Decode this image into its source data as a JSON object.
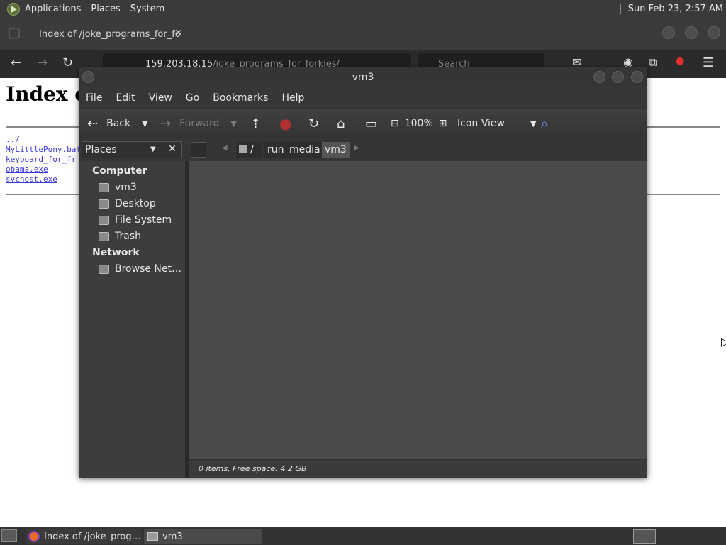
{
  "top_panel": {
    "menus": [
      "Applications",
      "Places",
      "System"
    ],
    "clock": "Sun Feb 23,  2:57 AM"
  },
  "firefox": {
    "tab_title": "Index of /joke_programs_for_fo",
    "tab_close": "×",
    "url_host": "159.203.18.15",
    "url_path": "/joke_programs_for_forkies/",
    "search_placeholder": "Search"
  },
  "page": {
    "heading": "Index of /joke_programs_for_forkies/",
    "links": [
      "../",
      "MyLittlePony.bat",
      "keyboard_for_fr",
      "obama.exe",
      "svchost.exe"
    ]
  },
  "file_manager": {
    "title": "vm3",
    "menu": [
      "File",
      "Edit",
      "View",
      "Go",
      "Bookmarks",
      "Help"
    ],
    "toolbar": {
      "back": "Back",
      "forward": "Forward",
      "zoom": "100%",
      "view_mode": "Icon View"
    },
    "places_label": "Places",
    "breadcrumbs": [
      "/",
      "run",
      "media",
      "vm3"
    ],
    "sidebar": {
      "computer_header": "Computer",
      "computer_items": [
        "vm3",
        "Desktop",
        "File System",
        "Trash"
      ],
      "network_header": "Network",
      "network_items": [
        "Browse Net…"
      ]
    },
    "status": "0 items, Free space: 4.2 GB"
  },
  "taskbar": {
    "items": [
      "Index of /joke_prog…",
      "vm3"
    ]
  }
}
